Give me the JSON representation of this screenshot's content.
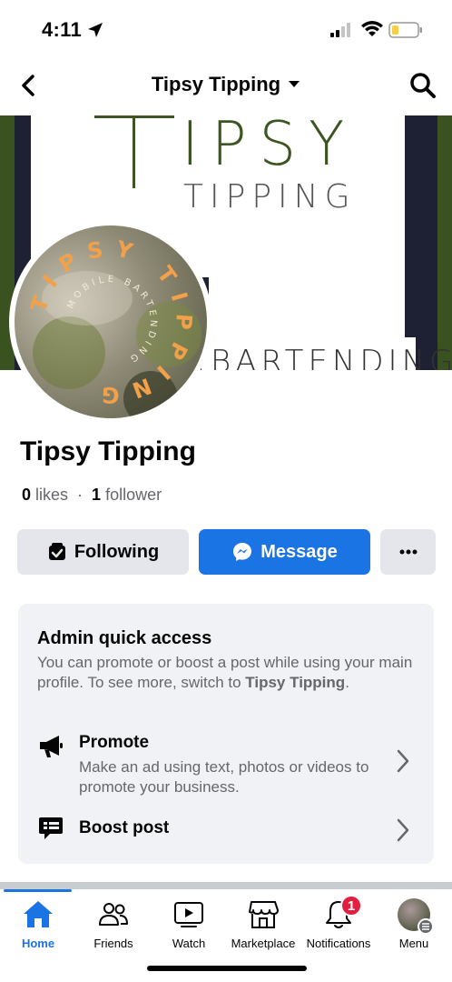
{
  "status_bar": {
    "time": "4:11"
  },
  "header": {
    "title": "Tipsy Tipping"
  },
  "cover": {
    "logo_letter": "T",
    "logo_rest": "IPSY",
    "logo_sub": "TIPPING",
    "logo_bottom": "BARTENDING"
  },
  "avatar": {
    "ring_text": "TIPSY TIPPING",
    "inner_text": "MOBILE BARTENDING"
  },
  "profile": {
    "name": "Tipsy Tipping",
    "likes_count": "0",
    "likes_label": "likes",
    "separator": "·",
    "followers_count": "1",
    "followers_label": "follower"
  },
  "actions": {
    "following_label": "Following",
    "message_label": "Message"
  },
  "admin": {
    "title": "Admin quick access",
    "desc_prefix": "You can promote or boost a post while using your main profile. To see more, switch to ",
    "desc_name": "Tipsy Tipping",
    "desc_suffix": ".",
    "promote_title": "Promote",
    "promote_sub": "Make an ad using text, photos or videos to promote your business.",
    "boost_title": "Boost post"
  },
  "tabs": [
    {
      "label": "Home",
      "icon": "home-icon"
    },
    {
      "label": "Friends",
      "icon": "friends-icon"
    },
    {
      "label": "Watch",
      "icon": "watch-icon"
    },
    {
      "label": "Marketplace",
      "icon": "marketplace-icon"
    },
    {
      "label": "Notifications",
      "icon": "bell-icon",
      "badge": "1"
    },
    {
      "label": "Menu",
      "icon": "profile-avatar"
    }
  ],
  "colors": {
    "accent": "#1b74e4",
    "badge": "#e41e3f",
    "cover_green": "#39521f",
    "avatar_text": "#f3a04a"
  }
}
